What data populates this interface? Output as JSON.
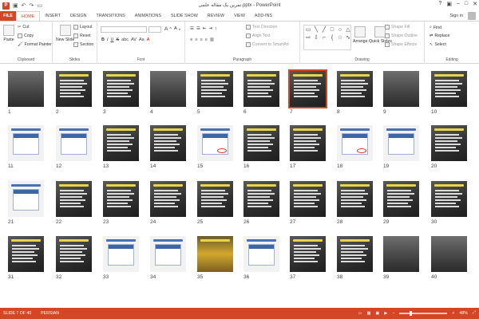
{
  "titlebar": {
    "title": "تمرین یک مقاله علمی.pptx - PowerPoint",
    "app_badge": "P"
  },
  "tabs": {
    "file": "FILE",
    "items": [
      "HOME",
      "INSERT",
      "DESIGN",
      "TRANSITIONS",
      "ANIMATIONS",
      "SLIDE SHOW",
      "REVIEW",
      "VIEW",
      "ADD-INS"
    ],
    "active": "HOME",
    "signin": "Sign in"
  },
  "ribbon": {
    "clipboard": {
      "label": "Clipboard",
      "paste": "Paste",
      "cut": "Cut",
      "copy": "Copy",
      "format_painter": "Format Painter"
    },
    "slides": {
      "label": "Slides",
      "new_slide": "New Slide",
      "layout": "Layout",
      "reset": "Reset",
      "section": "Section"
    },
    "font": {
      "label": "Font",
      "bold": "B",
      "italic": "I",
      "underline": "U",
      "strike": "S",
      "shadow": "abc",
      "spacing": "AV",
      "case": "Aa",
      "color": "A"
    },
    "paragraph": {
      "label": "Paragraph",
      "text_direction": "Text Direction",
      "align_text": "Align Text",
      "convert_smartart": "Convert to SmartArt"
    },
    "drawing": {
      "label": "Drawing",
      "arrange": "Arrange",
      "quick_styles": "Quick Styles",
      "shape_fill": "Shape Fill",
      "shape_outline": "Shape Outline",
      "shape_effects": "Shape Effects"
    },
    "editing": {
      "label": "Editing",
      "find": "Find",
      "replace": "Replace",
      "select": "Select"
    }
  },
  "slides": [
    {
      "n": "1",
      "style": "photo"
    },
    {
      "n": "2",
      "style": "dark"
    },
    {
      "n": "3",
      "style": "dark"
    },
    {
      "n": "4",
      "style": "photo"
    },
    {
      "n": "5",
      "style": "dark"
    },
    {
      "n": "6",
      "style": "dark"
    },
    {
      "n": "7",
      "style": "dark"
    },
    {
      "n": "8",
      "style": "dark"
    },
    {
      "n": "9",
      "style": "photo"
    },
    {
      "n": "10",
      "style": "dark"
    },
    {
      "n": "11",
      "style": "light"
    },
    {
      "n": "12",
      "style": "light"
    },
    {
      "n": "13",
      "style": "dark"
    },
    {
      "n": "14",
      "style": "dark"
    },
    {
      "n": "15",
      "style": "light"
    },
    {
      "n": "16",
      "style": "dark"
    },
    {
      "n": "17",
      "style": "dark"
    },
    {
      "n": "18",
      "style": "light"
    },
    {
      "n": "19",
      "style": "light"
    },
    {
      "n": "20",
      "style": "dark"
    },
    {
      "n": "21",
      "style": "light"
    },
    {
      "n": "22",
      "style": "dark"
    },
    {
      "n": "23",
      "style": "dark"
    },
    {
      "n": "24",
      "style": "dark"
    },
    {
      "n": "25",
      "style": "dark"
    },
    {
      "n": "26",
      "style": "dark"
    },
    {
      "n": "27",
      "style": "dark"
    },
    {
      "n": "28",
      "style": "dark"
    },
    {
      "n": "29",
      "style": "dark"
    },
    {
      "n": "30",
      "style": "dark"
    },
    {
      "n": "31",
      "style": "dark"
    },
    {
      "n": "32",
      "style": "dark"
    },
    {
      "n": "33",
      "style": "light"
    },
    {
      "n": "34",
      "style": "light"
    },
    {
      "n": "35",
      "style": "yellow"
    },
    {
      "n": "36",
      "style": "light"
    },
    {
      "n": "37",
      "style": "dark"
    },
    {
      "n": "38",
      "style": "dark"
    },
    {
      "n": "39",
      "style": "photo"
    },
    {
      "n": "40",
      "style": "photo"
    }
  ],
  "selected_slide": "7",
  "status": {
    "slide": "SLIDE 7 OF 40",
    "language": "PERSIAN",
    "zoom": "48%",
    "zoom_percent": 48
  },
  "colors": {
    "accent": "#d24726"
  }
}
